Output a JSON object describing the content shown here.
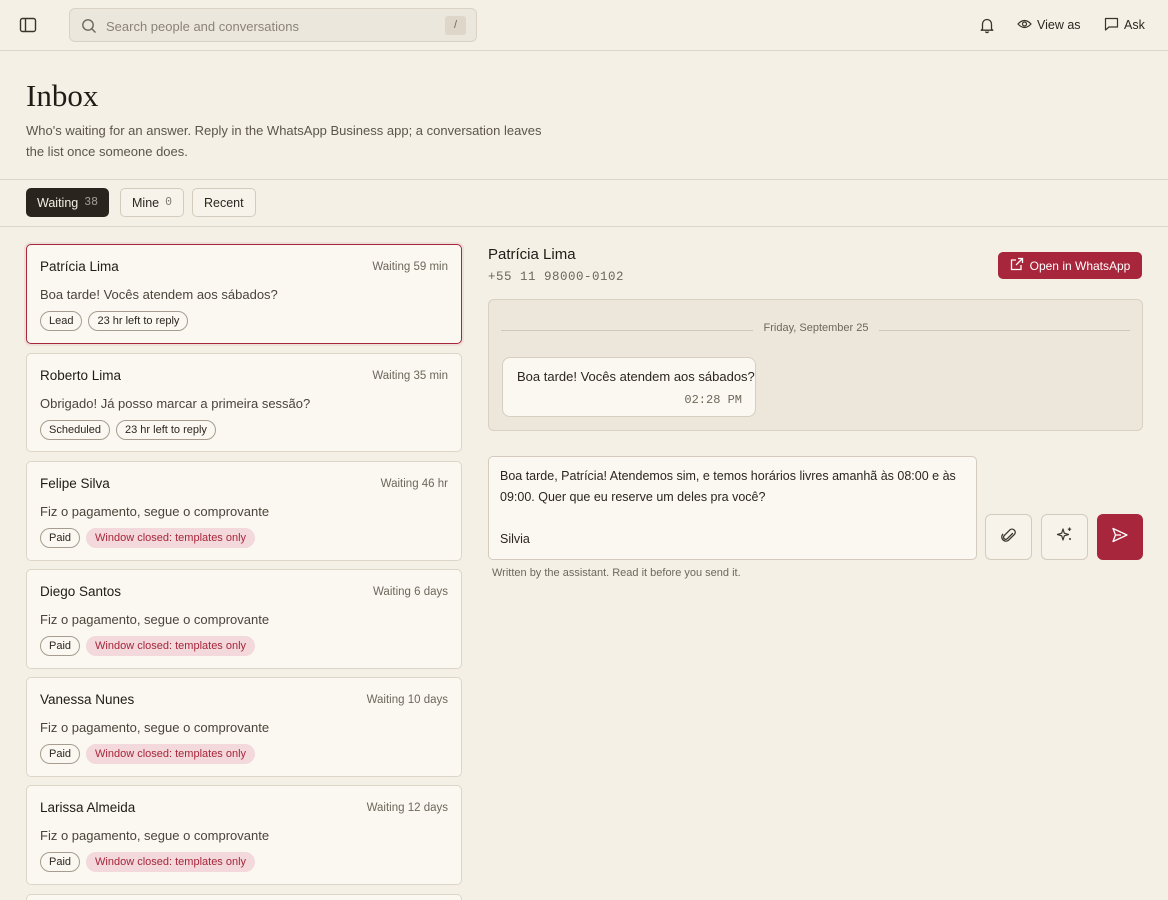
{
  "search": {
    "placeholder": "Search people and conversations",
    "shortcut": "/"
  },
  "topbar": {
    "view_as": "View as",
    "ask": "Ask"
  },
  "header": {
    "title": "Inbox",
    "subtitle": "Who's waiting for an answer. Reply in the WhatsApp Business app; a conversation leaves the list once someone does."
  },
  "tabs": [
    {
      "label": "Waiting",
      "count": "38"
    },
    {
      "label": "Mine",
      "count": "0"
    },
    {
      "label": "Recent",
      "count": ""
    }
  ],
  "conversations": [
    {
      "name": "Patrícia Lima",
      "waiting": "Waiting 59 min",
      "message": "Boa tarde! Vocês atendem aos sábados?",
      "tags": [
        "Lead",
        "23 hr left to reply"
      ],
      "selected": true
    },
    {
      "name": "Roberto Lima",
      "waiting": "Waiting 35 min",
      "message": "Obrigado! Já posso marcar a primeira sessão?",
      "tags": [
        "Scheduled",
        "23 hr left to reply"
      ]
    },
    {
      "name": "Felipe Silva",
      "waiting": "Waiting 46 hr",
      "message": "Fiz o pagamento, segue o comprovante",
      "tags": [
        "Paid",
        "Window closed: templates only"
      ]
    },
    {
      "name": "Diego Santos",
      "waiting": "Waiting 6 days",
      "message": "Fiz o pagamento, segue o comprovante",
      "tags": [
        "Paid",
        "Window closed: templates only"
      ]
    },
    {
      "name": "Vanessa Nunes",
      "waiting": "Waiting 10 days",
      "message": "Fiz o pagamento, segue o comprovante",
      "tags": [
        "Paid",
        "Window closed: templates only"
      ]
    },
    {
      "name": "Larissa Almeida",
      "waiting": "Waiting 12 days",
      "message": "Fiz o pagamento, segue o comprovante",
      "tags": [
        "Paid",
        "Window closed: templates only"
      ]
    }
  ],
  "detail": {
    "name": "Patrícia Lima",
    "phone": "+55 11 98000-0102",
    "open_button": "Open in WhatsApp",
    "date_label": "Friday, September 25",
    "message": {
      "text": "Boa tarde! Vocês atendem aos sábados?",
      "time": "02:28 PM"
    },
    "draft": "Boa tarde, Patrícia! Atendemos sim, e temos horários livres amanhã às 08:00 e às 09:00. Quer que eu reserve um deles pra você?\n\nSilvia",
    "assist_note": "Written by the assistant. Read it before you send it."
  },
  "colors": {
    "accent": "#a8263b",
    "background": "#f4f0e6",
    "dark_tab": "#2a241e",
    "warn_tag_bg": "#f3d9dc"
  }
}
